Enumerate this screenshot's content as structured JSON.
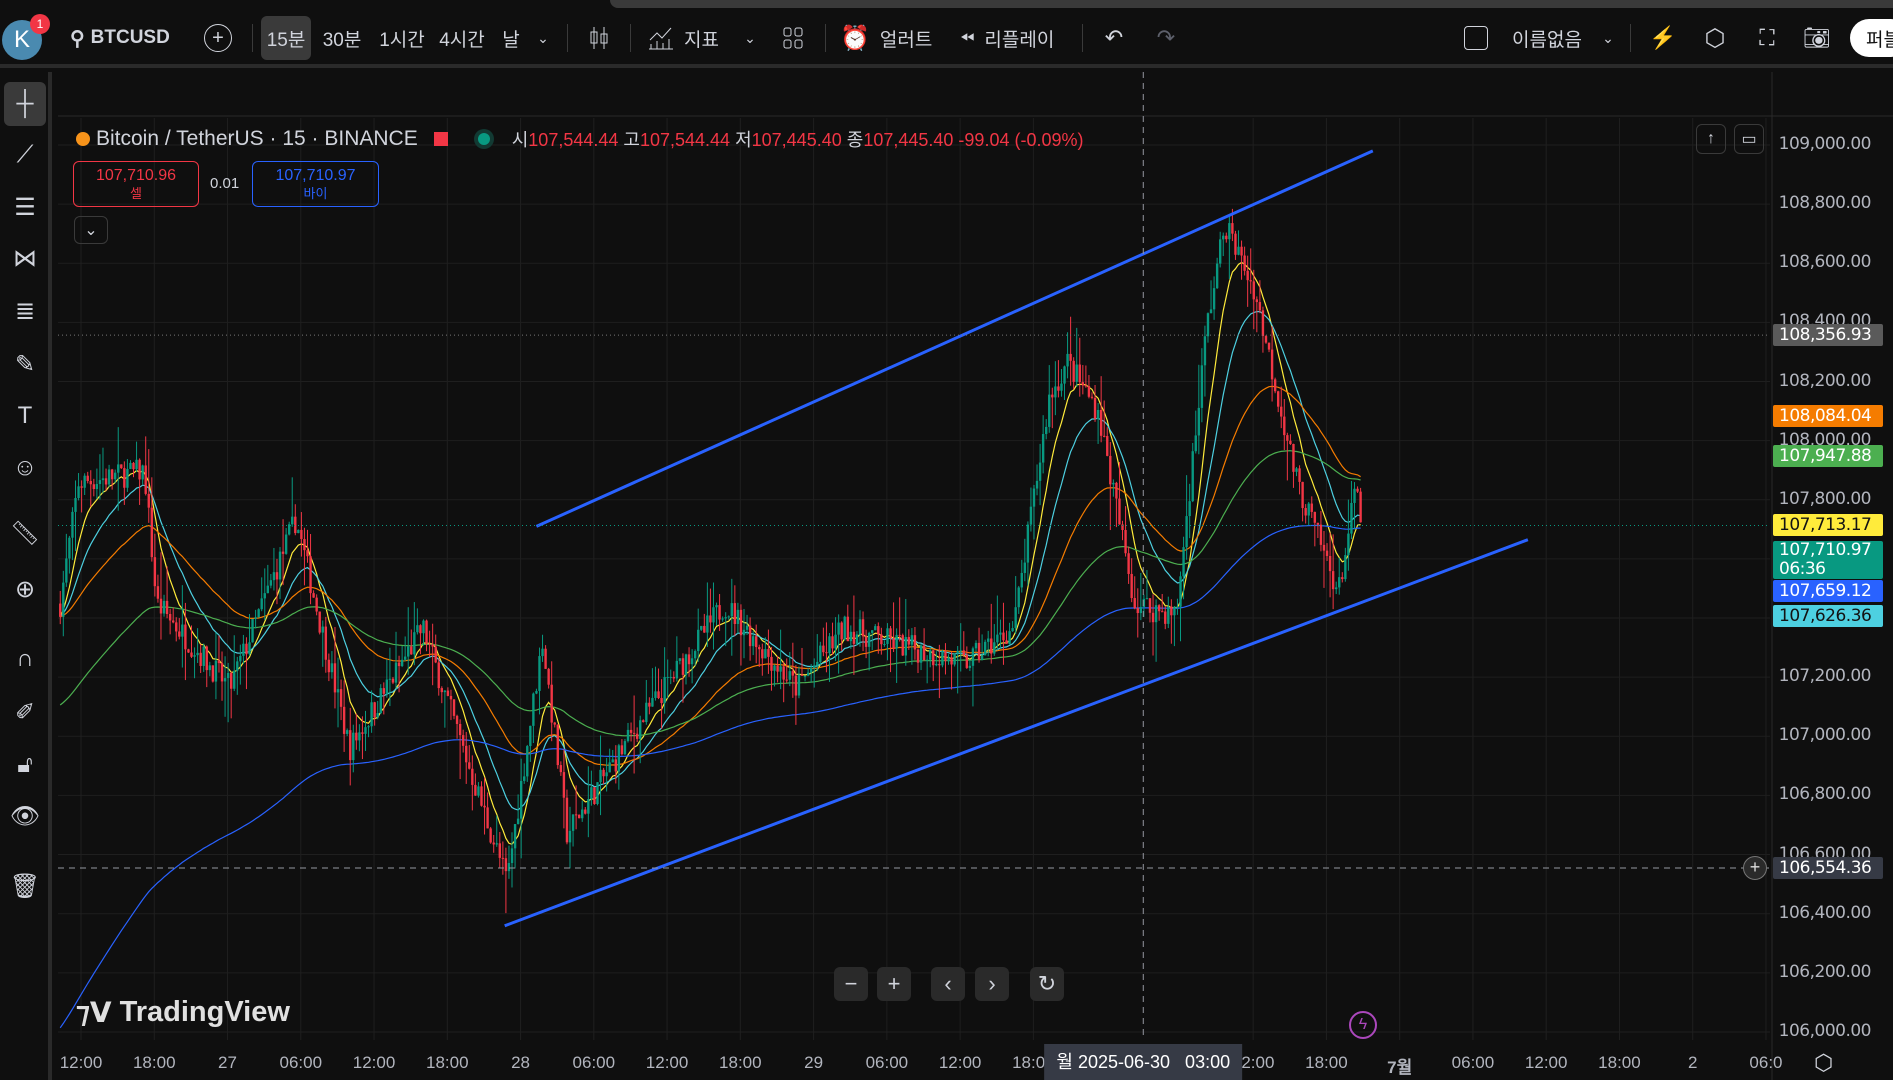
{
  "toolbar": {
    "avatar_letter": "K",
    "notification_count": "1",
    "symbol": "BTCUSD",
    "intervals": [
      "15분",
      "30분",
      "1시간",
      "4시간",
      "날"
    ],
    "active_interval": "15분",
    "indicators_label": "지표",
    "alert_label": "얼러트",
    "replay_label": "리플레이",
    "layout_name": "이름없음",
    "publish_label": "퍼블"
  },
  "legend": {
    "title": "Bitcoin / TetherUS · 15 · BINANCE",
    "open_label": "시",
    "open": "107,544.44",
    "high_label": "고",
    "high": "107,544.44",
    "low_label": "저",
    "low": "107,445.40",
    "close_label": "종",
    "close": "107,445.40",
    "change": "-99.04 (-0.09%)"
  },
  "trade": {
    "sell_price": "107,710.96",
    "sell_label": "셀",
    "spread": "0.01",
    "buy_price": "107,710.97",
    "buy_label": "바이"
  },
  "price_axis": {
    "ticks": [
      "109,000.00",
      "108,800.00",
      "108,600.00",
      "108,400.00",
      "108,200.00",
      "108,000.00",
      "107,800.00",
      "107,600.00",
      "107,400.00",
      "107,200.00",
      "107,000.00",
      "106,800.00",
      "106,600.00",
      "106,400.00",
      "106,200.00",
      "106,000.00"
    ],
    "badges": [
      {
        "value": "108,356.93",
        "price": 108356.93,
        "bg": "#5a5a5a",
        "fg": "#ffffff"
      },
      {
        "value": "108,084.04",
        "price": 108084.04,
        "bg": "#f57c00",
        "fg": "#ffffff"
      },
      {
        "value": "107,947.88",
        "price": 107947.88,
        "bg": "#4caf50",
        "fg": "#ffffff"
      },
      {
        "value": "107,713.17",
        "price": 107713.17,
        "bg": "#ffeb3b",
        "fg": "#131313"
      },
      {
        "value": "107,710.97",
        "sub": "06:36",
        "price": 107710.97,
        "bg": "#089981",
        "fg": "#ffffff"
      },
      {
        "value": "107,659.12",
        "price": 107659.12,
        "bg": "#2962ff",
        "fg": "#ffffff"
      },
      {
        "value": "107,626.36",
        "price": 107626.36,
        "bg": "#4dd0e1",
        "fg": "#131313"
      }
    ],
    "crosshair_value": "106,554.36"
  },
  "time_axis": {
    "labels": [
      [
        "12:00",
        0
      ],
      [
        "18:00",
        6
      ],
      [
        "27",
        12
      ],
      [
        "06:00",
        18
      ],
      [
        "12:00",
        24
      ],
      [
        "18:00",
        30
      ],
      [
        "28",
        36
      ],
      [
        "06:00",
        42
      ],
      [
        "12:00",
        48
      ],
      [
        "18:00",
        54
      ],
      [
        "29",
        60
      ],
      [
        "06:00",
        66
      ],
      [
        "12:00",
        72
      ],
      [
        "18:00",
        78
      ],
      [
        "12:00",
        96
      ],
      [
        "18:00",
        102
      ],
      [
        "7월",
        108
      ],
      [
        "06:00",
        114
      ],
      [
        "12:00",
        120
      ],
      [
        "18:00",
        126
      ],
      [
        "2",
        132
      ],
      [
        "06:0",
        138
      ]
    ],
    "crosshair_label": "월 2025-06-30   03:00"
  },
  "brand": "TradingView",
  "chart_data": {
    "type": "candlestick",
    "x_unit": "hours since 06-26 12:00",
    "crosshair_hours": 87,
    "crosshair_price": 106554.36,
    "price_path": [
      [
        -1.7,
        107449
      ],
      [
        -0.2,
        107857
      ],
      [
        5.2,
        107898
      ],
      [
        6.2,
        107449
      ],
      [
        12.2,
        107163
      ],
      [
        17.6,
        107735
      ],
      [
        22,
        106959
      ],
      [
        28,
        107367
      ],
      [
        34.9,
        106510
      ],
      [
        37.8,
        107327
      ],
      [
        39.8,
        106673
      ],
      [
        45.7,
        107041
      ],
      [
        52.7,
        107449
      ],
      [
        58.6,
        107163
      ],
      [
        62.5,
        107367
      ],
      [
        72.4,
        107245
      ],
      [
        76.4,
        107367
      ],
      [
        79.3,
        108143
      ],
      [
        80.8,
        108265
      ],
      [
        83.3,
        108102
      ],
      [
        86.3,
        107449
      ],
      [
        89.7,
        107408
      ],
      [
        92.2,
        108388
      ],
      [
        93.7,
        108735
      ],
      [
        96.1,
        108510
      ],
      [
        99.6,
        107857
      ],
      [
        103,
        107490
      ],
      [
        104.5,
        107857
      ],
      [
        104.8,
        107694
      ]
    ],
    "trendlines": [
      [
        [
          37.3,
          107710
        ],
        [
          105.8,
          108980
        ]
      ],
      [
        [
          34.7,
          106359
        ],
        [
          118.5,
          107665
        ]
      ]
    ],
    "moving_averages": [
      {
        "period": 9,
        "color": "#ffeb3b"
      },
      {
        "period": 20,
        "color": "#4dd0e1"
      },
      {
        "period": 50,
        "color": "#f57c00"
      },
      {
        "period": 100,
        "color": "#4caf50"
      },
      {
        "period": 200,
        "color": "#2962ff"
      }
    ],
    "colors": {
      "up": "#089981",
      "down": "#f23645",
      "trendline": "#2962ff"
    }
  }
}
